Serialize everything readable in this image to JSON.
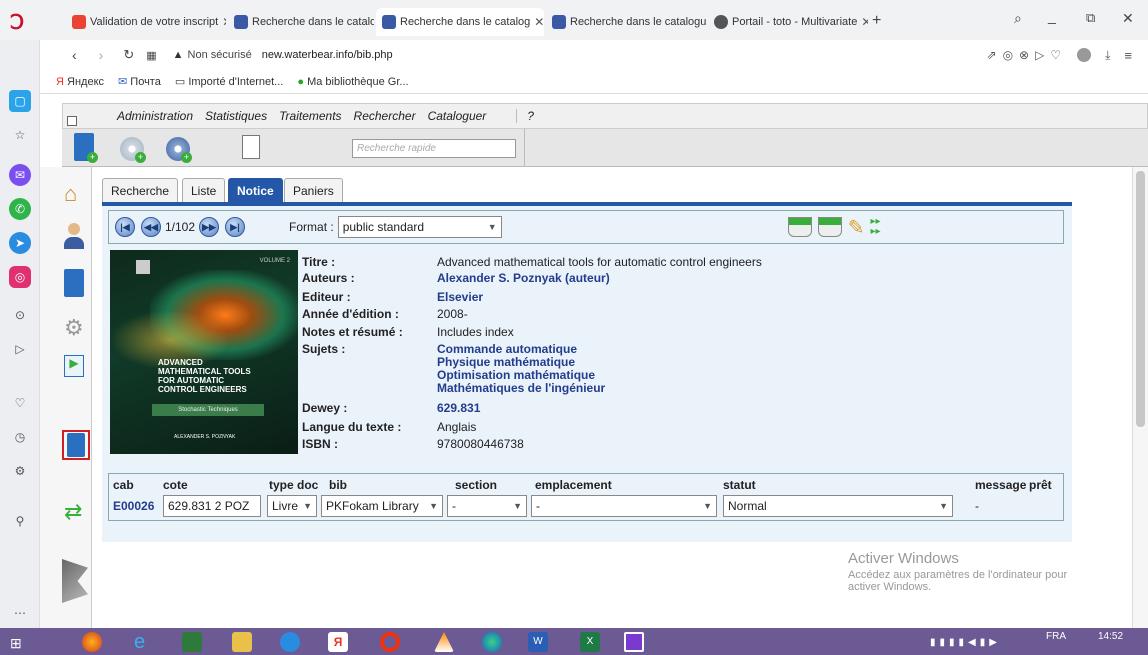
{
  "browser": {
    "tabs": [
      {
        "title": "Validation de votre inscript",
        "favicon": "gmail-icon"
      },
      {
        "title": "Recherche dans le catalogu",
        "favicon": "waterbear-icon"
      },
      {
        "title": "Recherche dans le catalog",
        "favicon": "waterbear-icon",
        "active": true
      },
      {
        "title": "Recherche dans le catalogu",
        "favicon": "waterbear-icon"
      },
      {
        "title": "Portail - toto - Multivariate",
        "favicon": "globe-icon"
      }
    ],
    "security": "Non sécurisé",
    "url": "new.waterbear.info/bib.php",
    "bookmarks": [
      "Яндекс",
      "Почта",
      "Importé d'Internet...",
      "Ma bibliothèque Gr..."
    ]
  },
  "app": {
    "menu": [
      "Administration",
      "Statistiques",
      "Traitements",
      "Rechercher",
      "Cataloguer",
      "?"
    ],
    "quick_search_placeholder": "Recherche rapide",
    "tabs": [
      "Recherche",
      "Liste",
      "Notice",
      "Paniers"
    ],
    "nav": {
      "counter": "1/102",
      "format_label": "Format :",
      "format_value": "public standard"
    },
    "book": {
      "cover_lines": [
        "ADVANCED",
        "MATHEMATICAL TOOLS",
        "FOR AUTOMATIC",
        "CONTROL ENGINEERS"
      ],
      "cover_sub": "Stochastic Techniques",
      "cover_author": "ALEXANDER S. POZNYAK",
      "cover_vol": "VOLUME 2"
    },
    "fields": {
      "titre_l": "Titre :",
      "titre_v": "Advanced mathematical tools for automatic control engineers",
      "auteurs_l": "Auteurs :",
      "auteurs_v": "Alexander S. Poznyak (auteur)",
      "editeur_l": "Editeur :",
      "editeur_v": "Elsevier",
      "annee_l": "Année d'édition :",
      "annee_v": "2008-",
      "notes_l": "Notes et résumé :",
      "notes_v": "Includes index",
      "sujets_l": "Sujets :",
      "sujets": [
        "Commande automatique",
        "Physique mathématique",
        "Optimisation mathématique",
        "Mathématiques de l'ingénieur"
      ],
      "dewey_l": "Dewey :",
      "dewey_v": "629.831",
      "langue_l": "Langue du texte :",
      "langue_v": "Anglais",
      "isbn_l": "ISBN :",
      "isbn_v": "9780080446738"
    },
    "exemplaire": {
      "headers": [
        "cab",
        "cote",
        "type doc",
        "bib",
        "section",
        "emplacement",
        "statut",
        "message",
        "prêt"
      ],
      "cab": "E00026",
      "cote": "629.831 2 POZ",
      "type_doc": "Livre",
      "bib": "PKFokam Library",
      "section": "-",
      "emplacement": "-",
      "statut": "Normal",
      "message": "-"
    }
  },
  "watermark": {
    "title": "Activer Windows",
    "line1": "Accédez aux paramètres de l'ordinateur pour",
    "line2": "activer Windows."
  },
  "taskbar": {
    "lang": "FRA",
    "time": "14:52"
  },
  "colors": {
    "accent": "#2457a8",
    "link": "#233c8c"
  }
}
